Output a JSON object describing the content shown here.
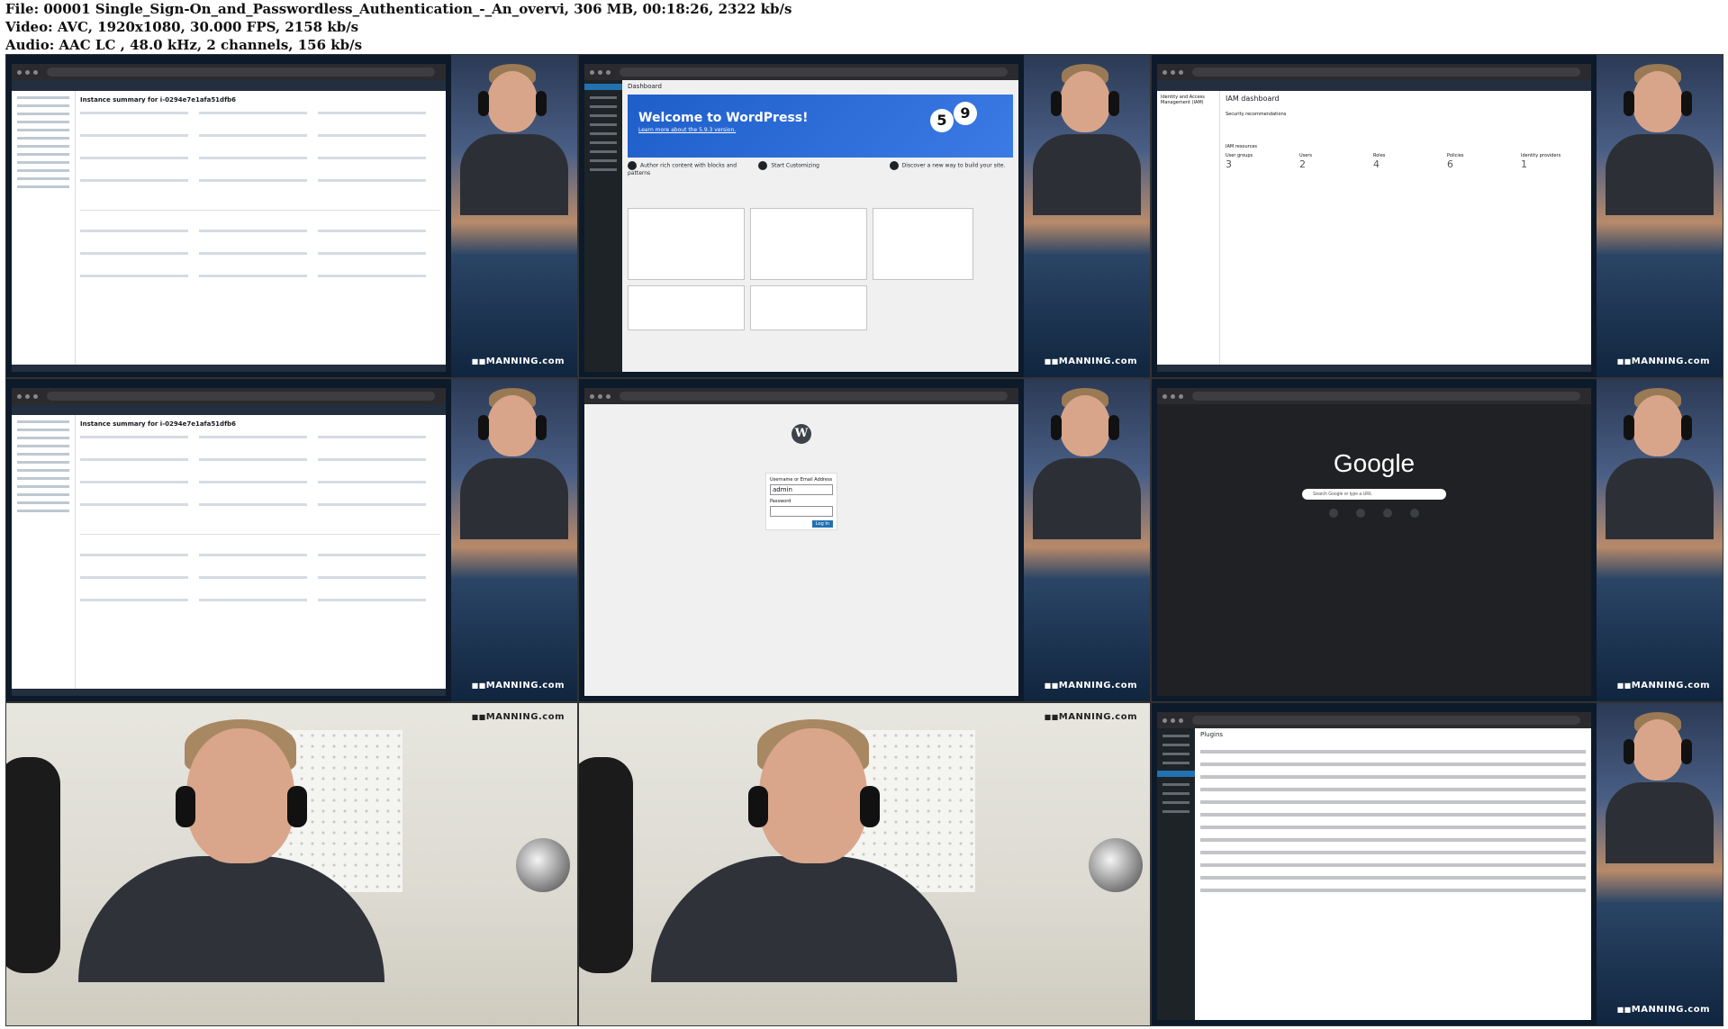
{
  "header": {
    "file_line": "File: 00001 Single_Sign-On_and_Passwordless_Authentication_-_An_overvi, 306 MB, 00:18:26, 2322 kb/s",
    "video_line": "Video: AVC, 1920x1080, 30.000 FPS, 2158 kb/s",
    "audio_line": "Audio: AAC LC , 48.0 kHz, 2 channels, 156 kb/s"
  },
  "watermark": "MANNING.com",
  "tiles": {
    "t1": {
      "kind": "aws-ec2",
      "page_title": "Instance summary for i-0294e7e1afa51dfb6"
    },
    "t2": {
      "kind": "wordpress-dashboard",
      "page_title": "Dashboard",
      "welcome_title": "Welcome to WordPress!",
      "welcome_link": "Learn more about the 5.9.3 version.",
      "version_major": "5",
      "version_minor": "9",
      "col1": "Author rich content with blocks and patterns",
      "col2": "Start Customizing",
      "col3": "Discover a new way to build your site."
    },
    "t3": {
      "kind": "aws-iam",
      "sidebar_title": "Identity and Access Management (IAM)",
      "page_title": "IAM dashboard",
      "section1": "Security recommendations",
      "section2": "IAM resources",
      "resources": [
        {
          "label": "User groups",
          "value": "3"
        },
        {
          "label": "Users",
          "value": "2"
        },
        {
          "label": "Roles",
          "value": "4"
        },
        {
          "label": "Policies",
          "value": "6"
        },
        {
          "label": "Identity providers",
          "value": "1"
        }
      ]
    },
    "t4": {
      "kind": "aws-ec2",
      "page_title": "Instance summary for i-0294e7e1afa51dfb6"
    },
    "t5": {
      "kind": "wordpress-login",
      "logo": "W",
      "username_label": "Username or Email Address",
      "username_value": "admin",
      "password_label": "Password",
      "login_button": "Log In"
    },
    "t6": {
      "kind": "google",
      "logo": "Google",
      "search_placeholder": "Search Google or type a URL"
    },
    "t7": {
      "kind": "webcam-full"
    },
    "t8": {
      "kind": "webcam-full"
    },
    "t9": {
      "kind": "wordpress-plugins",
      "page_title": "Plugins"
    }
  }
}
